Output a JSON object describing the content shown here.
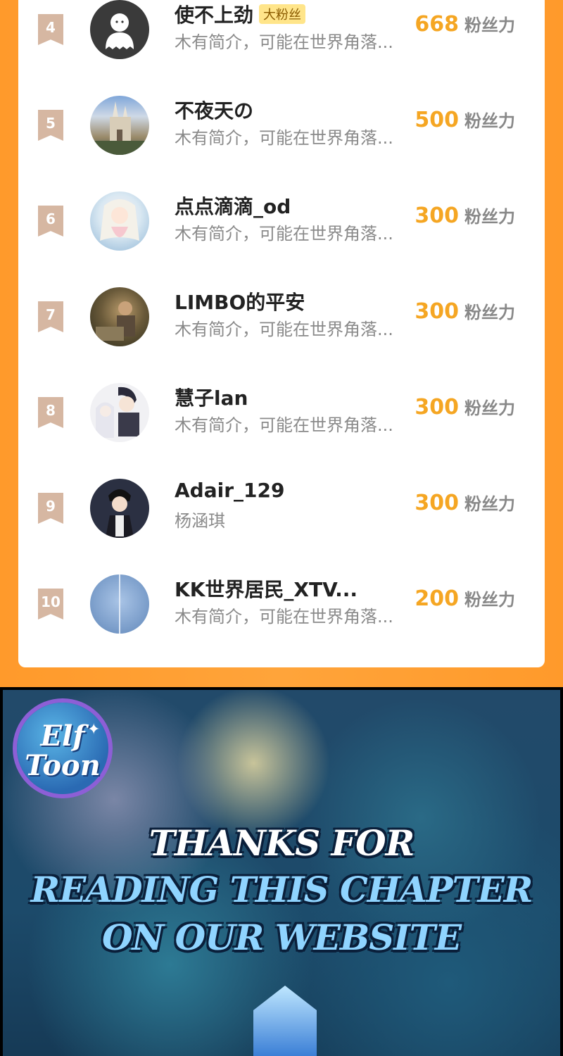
{
  "leaderboard": {
    "rows": [
      {
        "rank": "4",
        "name": "使不上劲",
        "badge": "大粉丝",
        "desc": "木有简介，可能在世界角落...",
        "score": "668",
        "unit": "粉丝力",
        "avatar": "ghost-avatar"
      },
      {
        "rank": "5",
        "name": "不夜天の",
        "badge": "",
        "desc": "木有简介，可能在世界角落...",
        "score": "500",
        "unit": "粉丝力",
        "avatar": "cathedral-avatar"
      },
      {
        "rank": "6",
        "name": "点点滴滴_od",
        "badge": "",
        "desc": "木有简介，可能在世界角落...",
        "score": "300",
        "unit": "粉丝力",
        "avatar": "anime-girl-avatar"
      },
      {
        "rank": "7",
        "name": "LIMBO的平安",
        "badge": "",
        "desc": "木有简介，可能在世界角落...",
        "score": "300",
        "unit": "粉丝力",
        "avatar": "photo-avatar"
      },
      {
        "rank": "8",
        "name": "慧子lan",
        "badge": "",
        "desc": "木有简介，可能在世界角落...",
        "score": "300",
        "unit": "粉丝力",
        "avatar": "manhwa-avatar"
      },
      {
        "rank": "9",
        "name": "Adair_129",
        "badge": "",
        "desc": "杨涵琪",
        "score": "300",
        "unit": "粉丝力",
        "avatar": "dark-hair-avatar"
      },
      {
        "rank": "10",
        "name": "KK世界居民_XTV...",
        "badge": "",
        "desc": "木有简介，可能在世界角落...",
        "score": "200",
        "unit": "粉丝力",
        "avatar": "sky-avatar"
      }
    ]
  },
  "banner": {
    "logo_top": "Elf",
    "logo_bottom": "Toon",
    "line1": "THANKS FOR",
    "line2": "READING THIS CHAPTER",
    "line3": "ON OUR WEBSITE"
  },
  "colors": {
    "accent": "#f5a623",
    "frame": "#ff9a2b",
    "rank_badge": "#d6b7a2"
  }
}
